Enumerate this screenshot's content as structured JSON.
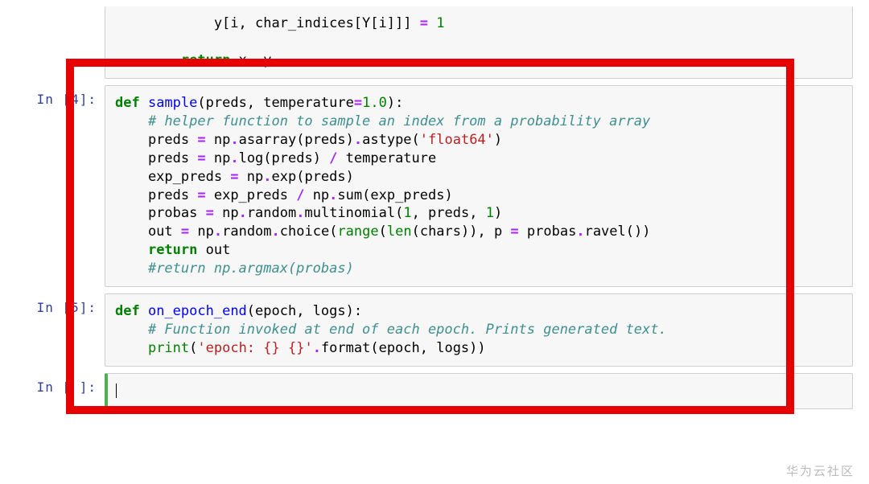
{
  "cells": [
    {
      "prompt": "",
      "tokens": [
        {
          "t": "            y[i, char_indices[Y[i]]] ",
          "c": "nm"
        },
        {
          "t": "=",
          "c": "op"
        },
        {
          "t": " ",
          "c": "nm"
        },
        {
          "t": "1",
          "c": "num"
        },
        {
          "t": "\n\n        ",
          "c": "nm"
        },
        {
          "t": "return",
          "c": "kw"
        },
        {
          "t": " x, y",
          "c": "nm"
        }
      ]
    },
    {
      "prompt": "In [4]:",
      "tokens": [
        {
          "t": "def",
          "c": "kw"
        },
        {
          "t": " ",
          "c": "nm"
        },
        {
          "t": "sample",
          "c": "fn"
        },
        {
          "t": "(preds, temperature",
          "c": "nm"
        },
        {
          "t": "=",
          "c": "op"
        },
        {
          "t": "1.0",
          "c": "num"
        },
        {
          "t": "):",
          "c": "nm"
        },
        {
          "t": "\n    ",
          "c": "nm"
        },
        {
          "t": "# helper function to sample an index from a probability array",
          "c": "cmt"
        },
        {
          "t": "\n    preds ",
          "c": "nm"
        },
        {
          "t": "=",
          "c": "op"
        },
        {
          "t": " np",
          "c": "nm"
        },
        {
          "t": ".",
          "c": "op"
        },
        {
          "t": "asarray(preds)",
          "c": "nm"
        },
        {
          "t": ".",
          "c": "op"
        },
        {
          "t": "astype(",
          "c": "nm"
        },
        {
          "t": "'float64'",
          "c": "str"
        },
        {
          "t": ")",
          "c": "nm"
        },
        {
          "t": "\n    preds ",
          "c": "nm"
        },
        {
          "t": "=",
          "c": "op"
        },
        {
          "t": " np",
          "c": "nm"
        },
        {
          "t": ".",
          "c": "op"
        },
        {
          "t": "log(preds) ",
          "c": "nm"
        },
        {
          "t": "/",
          "c": "op"
        },
        {
          "t": " temperature",
          "c": "nm"
        },
        {
          "t": "\n    exp_preds ",
          "c": "nm"
        },
        {
          "t": "=",
          "c": "op"
        },
        {
          "t": " np",
          "c": "nm"
        },
        {
          "t": ".",
          "c": "op"
        },
        {
          "t": "exp(preds)",
          "c": "nm"
        },
        {
          "t": "\n    preds ",
          "c": "nm"
        },
        {
          "t": "=",
          "c": "op"
        },
        {
          "t": " exp_preds ",
          "c": "nm"
        },
        {
          "t": "/",
          "c": "op"
        },
        {
          "t": " np",
          "c": "nm"
        },
        {
          "t": ".",
          "c": "op"
        },
        {
          "t": "sum(exp_preds)",
          "c": "nm"
        },
        {
          "t": "\n    probas ",
          "c": "nm"
        },
        {
          "t": "=",
          "c": "op"
        },
        {
          "t": " np",
          "c": "nm"
        },
        {
          "t": ".",
          "c": "op"
        },
        {
          "t": "random",
          "c": "nm"
        },
        {
          "t": ".",
          "c": "op"
        },
        {
          "t": "multinomial(",
          "c": "nm"
        },
        {
          "t": "1",
          "c": "num"
        },
        {
          "t": ", preds, ",
          "c": "nm"
        },
        {
          "t": "1",
          "c": "num"
        },
        {
          "t": ")",
          "c": "nm"
        },
        {
          "t": "\n    out ",
          "c": "nm"
        },
        {
          "t": "=",
          "c": "op"
        },
        {
          "t": " np",
          "c": "nm"
        },
        {
          "t": ".",
          "c": "op"
        },
        {
          "t": "random",
          "c": "nm"
        },
        {
          "t": ".",
          "c": "op"
        },
        {
          "t": "choice(",
          "c": "nm"
        },
        {
          "t": "range",
          "c": "bi"
        },
        {
          "t": "(",
          "c": "nm"
        },
        {
          "t": "len",
          "c": "bi"
        },
        {
          "t": "(chars)), p ",
          "c": "nm"
        },
        {
          "t": "=",
          "c": "op"
        },
        {
          "t": " probas",
          "c": "nm"
        },
        {
          "t": ".",
          "c": "op"
        },
        {
          "t": "ravel())",
          "c": "nm"
        },
        {
          "t": "\n    ",
          "c": "nm"
        },
        {
          "t": "return",
          "c": "kw"
        },
        {
          "t": " out",
          "c": "nm"
        },
        {
          "t": "\n    ",
          "c": "nm"
        },
        {
          "t": "#return np.argmax(probas)",
          "c": "cmt"
        }
      ]
    },
    {
      "prompt": "In [5]:",
      "tokens": [
        {
          "t": "def",
          "c": "kw"
        },
        {
          "t": " ",
          "c": "nm"
        },
        {
          "t": "on_epoch_end",
          "c": "fn"
        },
        {
          "t": "(epoch, logs):",
          "c": "nm"
        },
        {
          "t": "\n    ",
          "c": "nm"
        },
        {
          "t": "# Function invoked at end of each epoch. Prints generated text.",
          "c": "cmt"
        },
        {
          "t": "\n    ",
          "c": "nm"
        },
        {
          "t": "print",
          "c": "bi"
        },
        {
          "t": "(",
          "c": "nm"
        },
        {
          "t": "'epoch: {} {}'",
          "c": "str"
        },
        {
          "t": ".",
          "c": "op"
        },
        {
          "t": "format(epoch, logs))",
          "c": "nm"
        }
      ]
    },
    {
      "prompt": "In [ ]:",
      "tokens": []
    }
  ],
  "watermark": "华为云社区"
}
